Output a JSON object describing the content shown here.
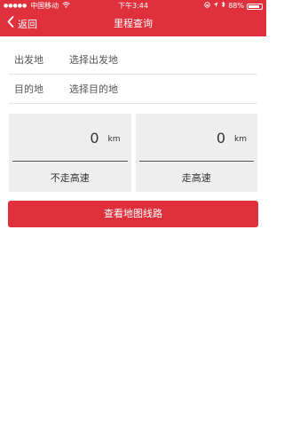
{
  "status_bar": {
    "carrier": "中国移动",
    "time": "下午3:44",
    "battery": "88%"
  },
  "navbar": {
    "back_label": "返回",
    "title": "里程查询"
  },
  "form": {
    "departure": {
      "label": "出发地",
      "placeholder": "选择出发地"
    },
    "destination": {
      "label": "目的地",
      "placeholder": "选择目的地"
    }
  },
  "cards": [
    {
      "value": "0",
      "unit": "km",
      "caption": "不走高速"
    },
    {
      "value": "0",
      "unit": "km",
      "caption": "走高速"
    }
  ],
  "actions": {
    "route_button": "查看地图线路"
  },
  "colors": {
    "accent": "#e0303c",
    "card_bg": "#eeeeee"
  }
}
